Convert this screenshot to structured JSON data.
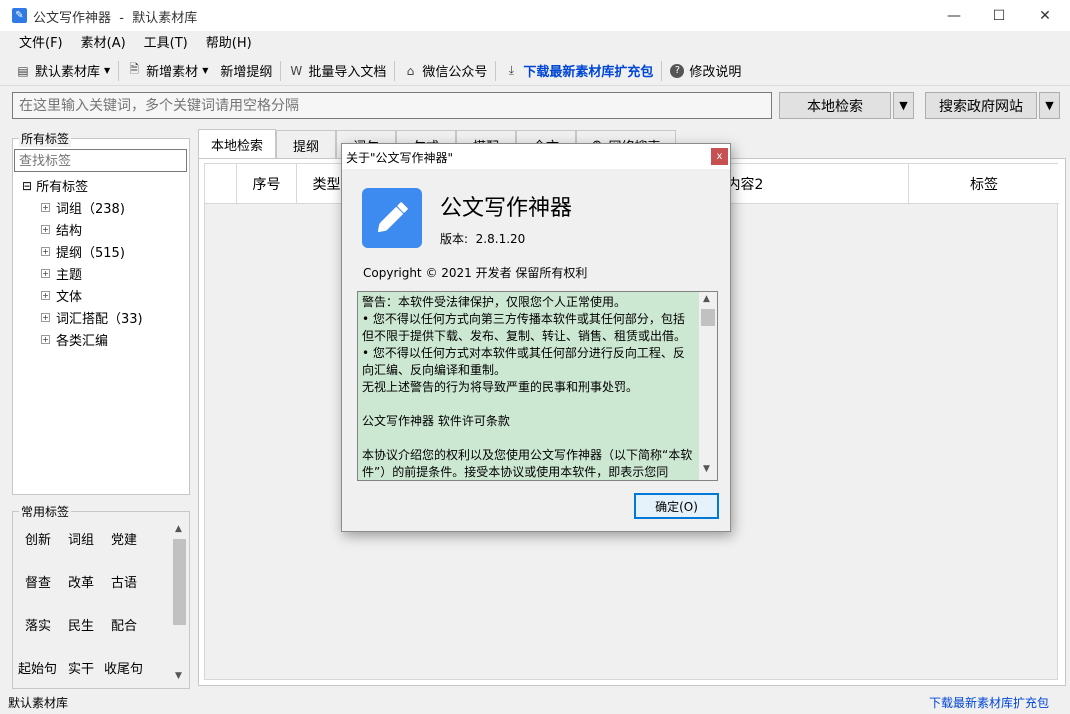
{
  "window": {
    "title": "公文写作神器  -  默认素材库",
    "minimize_icon": "—",
    "maximize_icon": "☐",
    "close_icon": "✕"
  },
  "menu": [
    "文件(F)",
    "素材(A)",
    "工具(T)",
    "帮助(H)"
  ],
  "toolbar": {
    "default_library": "默认素材库",
    "add_material": "新增素材",
    "add_outline": "新增提纲",
    "batch_import": "批量导入文档",
    "wechat": "微信公众号",
    "download_pack": "下载最新素材库扩充包",
    "changelog": "修改说明"
  },
  "search": {
    "placeholder": "在这里输入关键词，多个关键词请用空格分隔",
    "local_search": "本地检索",
    "gov_search": "搜索政府网站",
    "dropdown": "▼"
  },
  "left_panel": {
    "all_tags_title": "所有标签",
    "tag_search_placeholder": "查找标签",
    "tree_root": "所有标签",
    "tree_items": [
      "词组（238)",
      "结构",
      "提纲（515)",
      "主题",
      "文体",
      "词汇搭配（33)",
      "各类汇编"
    ],
    "common_tags_title": "常用标签",
    "common_tags": [
      "创新",
      "词组",
      "党建",
      "督查",
      "改革",
      "古语",
      "落实",
      "民生",
      "配合",
      "起始句",
      "实干",
      "收尾句"
    ]
  },
  "tabs": [
    "本地检索",
    "提纲",
    "词句",
    "句式",
    "搭配",
    "全文",
    "网络搜索"
  ],
  "table": {
    "columns": [
      "序号",
      "类型",
      "内容2",
      "标签"
    ]
  },
  "status": {
    "left": "默认素材库",
    "right_link": "下载最新素材库扩充包"
  },
  "dialog": {
    "title": "关于\"公文写作神器\"",
    "app_name": "公文写作神器",
    "version": "版本:  2.8.1.20",
    "copyright": "Copyright © 2021  开发者 保留所有权利",
    "license_lines": [
      "警告：本软件受法律保护，仅限您个人正常使用。",
      "• 您不得以任何方式向第三方传播本软件或其任何部分，包括但不限于提供下载、发布、复制、转让、销售、租赁或出借。",
      "• 您不得以任何方式对本软件或其任何部分进行反向工程、反向汇编、反向编译和重制。",
      "无视上述警告的行为将导致严重的民事和刑事处罚。",
      "",
      "公文写作神器 软件许可条款",
      "",
      "本协议介绍您的权利以及您使用公文写作神器（以下简称“本软件”）的前提条件。接受本协议或使用本软件，即表示您同"
    ],
    "ok": "确定(O)",
    "close_icon": "x"
  },
  "colors": {
    "accent": "#0046d5",
    "license_bg": "#cde8d2",
    "logo_bg": "#3d8af0"
  }
}
